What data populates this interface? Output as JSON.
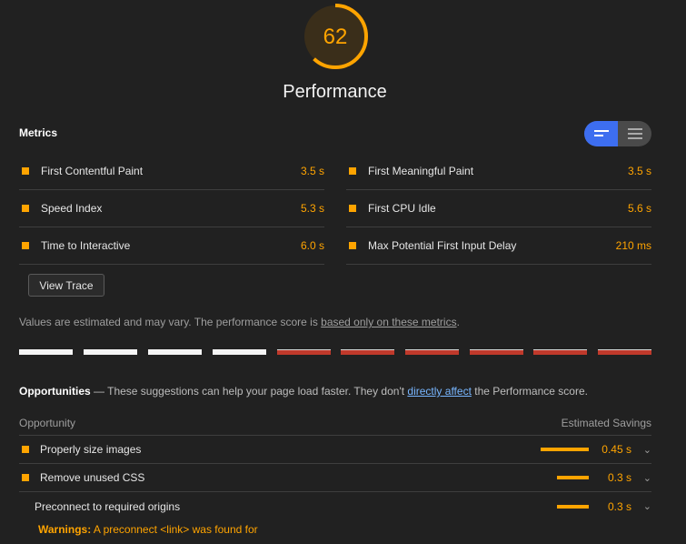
{
  "score": {
    "value": "62",
    "fraction": 0.62,
    "color": "#ffa400"
  },
  "category_title": "Performance",
  "metrics": {
    "title": "Metrics",
    "items": [
      {
        "label": "First Contentful Paint",
        "value": "3.5 s"
      },
      {
        "label": "First Meaningful Paint",
        "value": "3.5 s"
      },
      {
        "label": "Speed Index",
        "value": "5.3 s"
      },
      {
        "label": "First CPU Idle",
        "value": "5.6 s"
      },
      {
        "label": "Time to Interactive",
        "value": "6.0 s"
      },
      {
        "label": "Max Potential First Input Delay",
        "value": "210 ms"
      }
    ],
    "view_trace": "View Trace",
    "note_prefix": "Values are estimated and may vary. The performance score is ",
    "note_link": "based only on these metrics",
    "note_suffix": "."
  },
  "opportunities": {
    "title": "Opportunities",
    "desc_prefix": " — These suggestions can help your page load faster. They don't ",
    "desc_link": "directly affect",
    "desc_suffix": " the Performance score.",
    "col_opportunity": "Opportunity",
    "col_savings": "Estimated Savings",
    "items": [
      {
        "title": "Properly size images",
        "savings": "0.45 s"
      },
      {
        "title": "Remove unused CSS",
        "savings": "0.3 s"
      },
      {
        "title": "Preconnect to required origins",
        "savings": "0.3 s"
      }
    ],
    "warning_label": "Warnings:",
    "warning_text": " A preconnect <link> was found for"
  },
  "icons": {
    "toggle_left": "compact-list-icon",
    "toggle_right": "expanded-list-icon",
    "expand": "chevron-down-icon"
  }
}
